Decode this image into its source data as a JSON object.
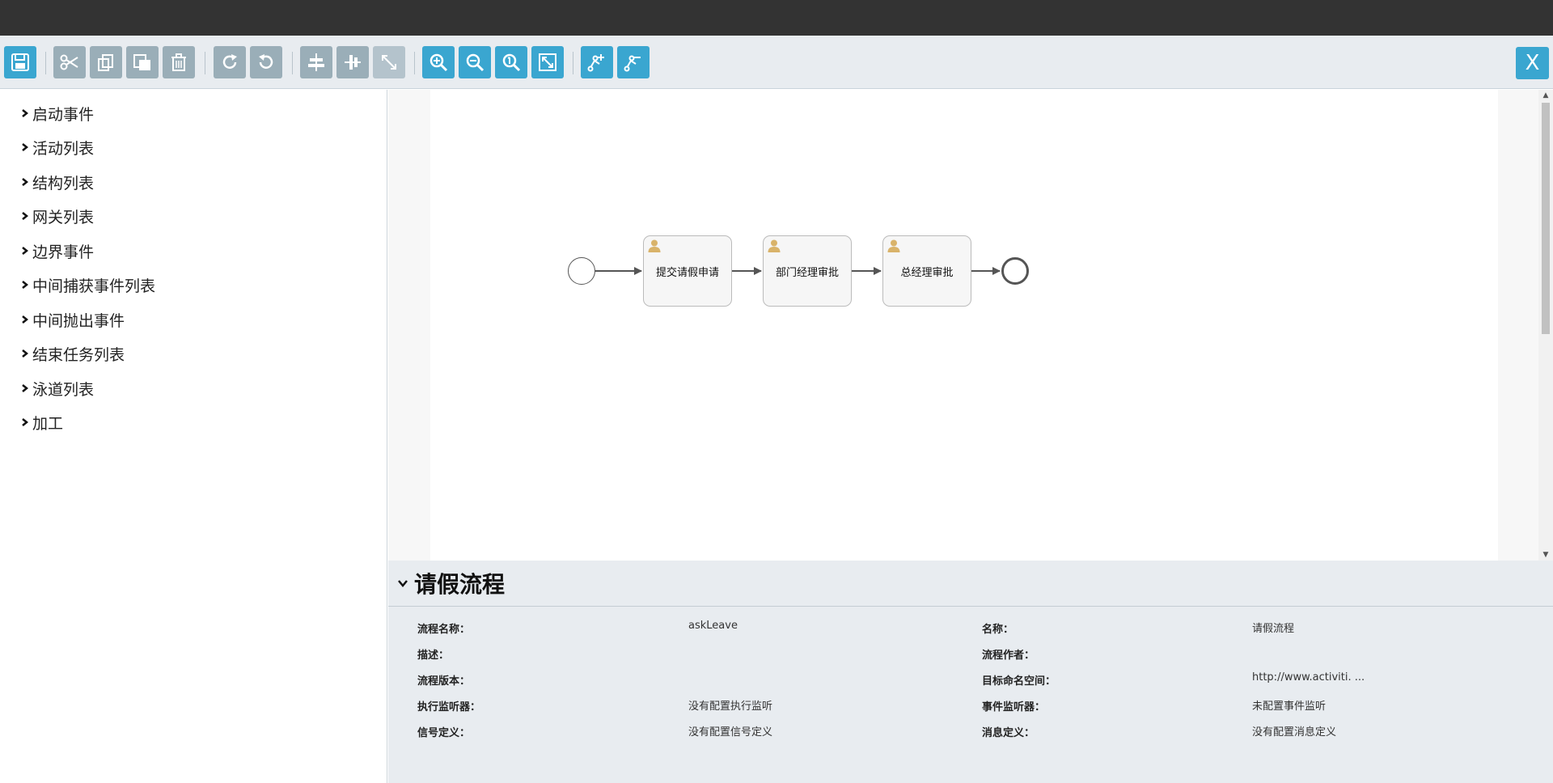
{
  "toolbar": {
    "buttons": [
      {
        "name": "save-button",
        "icon": "save-icon"
      },
      {
        "name": "cut-button",
        "icon": "scissors-icon"
      },
      {
        "name": "copy-button",
        "icon": "copy-icon"
      },
      {
        "name": "paste-button",
        "icon": "paste-icon"
      },
      {
        "name": "delete-button",
        "icon": "trash-icon"
      },
      {
        "name": "redo-button",
        "icon": "redo-icon"
      },
      {
        "name": "undo-button",
        "icon": "undo-icon"
      },
      {
        "name": "align-horizontal-button",
        "icon": "align-horizontal-icon"
      },
      {
        "name": "align-vertical-button",
        "icon": "align-vertical-icon"
      },
      {
        "name": "same-size-button",
        "icon": "resize-icon"
      },
      {
        "name": "zoom-in-button",
        "icon": "zoom-in-icon"
      },
      {
        "name": "zoom-out-button",
        "icon": "zoom-out-icon"
      },
      {
        "name": "zoom-actual-button",
        "icon": "zoom-actual-icon"
      },
      {
        "name": "zoom-fit-button",
        "icon": "fit-icon"
      },
      {
        "name": "add-bendpoint-button",
        "icon": "add-bendpoint-icon"
      },
      {
        "name": "remove-bendpoint-button",
        "icon": "remove-bendpoint-icon"
      }
    ],
    "close_label": "X"
  },
  "sidebar": {
    "items": [
      {
        "label": "启动事件"
      },
      {
        "label": "活动列表"
      },
      {
        "label": "结构列表"
      },
      {
        "label": "网关列表"
      },
      {
        "label": "边界事件"
      },
      {
        "label": "中间捕获事件列表"
      },
      {
        "label": "中间抛出事件"
      },
      {
        "label": "结束任务列表"
      },
      {
        "label": "泳道列表"
      },
      {
        "label": "加工"
      }
    ]
  },
  "diagram": {
    "tasks": [
      {
        "label": "提交请假申请"
      },
      {
        "label": "部门经理审批"
      },
      {
        "label": "总经理审批"
      }
    ],
    "colors": {
      "task_fill": "#f6f6f6",
      "task_border": "#bbbbbb",
      "flow": "#555555",
      "user_icon": "#d9b36a"
    }
  },
  "properties": {
    "title": "请假流程",
    "rows": [
      {
        "label": "流程名称：",
        "value": "askLeave",
        "label2": "名称：",
        "value2": "请假流程"
      },
      {
        "label": "描述：",
        "value": "",
        "label2": "流程作者：",
        "value2": ""
      },
      {
        "label": "流程版本：",
        "value": "",
        "label2": "目标命名空间：",
        "value2": "http://www.activiti. ..."
      },
      {
        "label": "执行监听器：",
        "value": "没有配置执行监听",
        "label2": "事件监听器：",
        "value2": "未配置事件监听"
      },
      {
        "label": "信号定义：",
        "value": "没有配置信号定义",
        "label2": "消息定义：",
        "value2": "没有配置消息定义"
      }
    ]
  }
}
